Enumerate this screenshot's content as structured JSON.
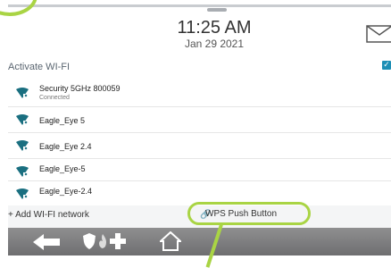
{
  "header": {
    "time": "11:25 AM",
    "date": "Jan 29 2021",
    "mail_icon": "envelope-icon"
  },
  "wifi": {
    "activate_label": "Activate WI-FI",
    "activate_checked": true,
    "networks": [
      {
        "name": "Security 5GHz 800059",
        "status": "Connected"
      },
      {
        "name": "Eagle_Eye 5",
        "status": ""
      },
      {
        "name": "Eagle_Eye 2.4",
        "status": ""
      },
      {
        "name": "Eagle_Eye-5",
        "status": ""
      },
      {
        "name": "Eagle_Eye-2.4",
        "status": ""
      }
    ],
    "add_network_label": "+ Add WI-FI network",
    "wps_label": "WPS Push Button"
  },
  "navbar": {
    "icons": [
      "back-arrow-icon",
      "security-shield-icon",
      "fire-icon",
      "medical-cross-icon",
      "home-icon"
    ]
  },
  "colors": {
    "accent_green": "#a9d444",
    "wifi_teal": "#1a6f80",
    "checkbox_blue": "#1e8fb5"
  }
}
